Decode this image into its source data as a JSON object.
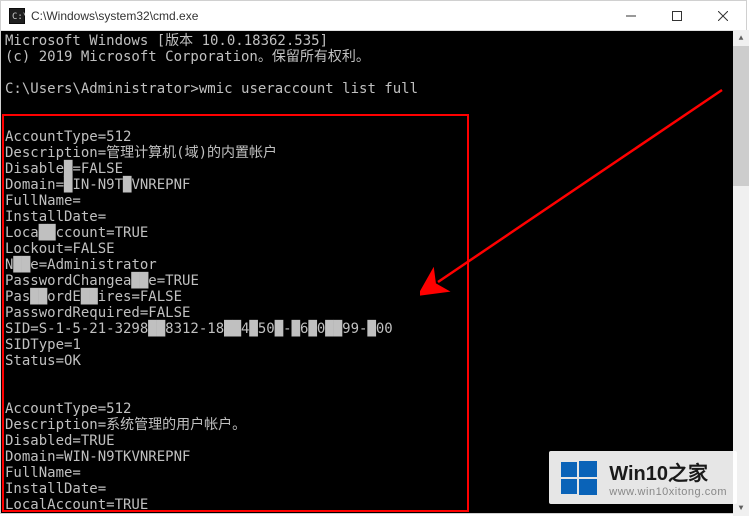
{
  "window": {
    "title": "C:\\Windows\\system32\\cmd.exe"
  },
  "terminal": {
    "banner1": "Microsoft Windows [版本 10.0.18362.535]",
    "banner2": "(c) 2019 Microsoft Corporation。保留所有权利。",
    "prompt": "C:\\Users\\Administrator>",
    "command": "wmic useraccount list full",
    "accounts": [
      {
        "AccountType": "512",
        "Description": "管理计算机(域)的内置帐户",
        "Disabled": "FALSE",
        "Domain": "WIN-N9TKVNREPNF",
        "FullName": "",
        "InstallDate": "",
        "LocalAccount": "TRUE",
        "Lockout": "FALSE",
        "Name": "Administrator",
        "PasswordChangeable": "TRUE",
        "PasswordExpires": "FALSE",
        "PasswordRequired": "FALSE",
        "SID": "S-1-5-21-3298██8312-18██4█50█-█6█0██99-█00",
        "SIDType": "1",
        "Status": "OK"
      },
      {
        "AccountType": "512",
        "Description": "系统管理的用户帐户。",
        "Disabled": "TRUE",
        "Domain": "WIN-N9TKVNREPNF",
        "FullName": "",
        "InstallDate": "",
        "LocalAccount": "TRUE"
      }
    ],
    "masked": {
      "Disabled_label": "Disable█",
      "Domain_value": "█IN-N9T█VNREPNF",
      "LocalAccount_label": "Loca██ccount",
      "Name_label": "N██e",
      "PasswordChangeable_label": "PasswordChangea██e",
      "PasswordExpires_label": "Pas██ordE██ires",
      "SID_value": "S-1-5-21-3298██8312-18██4█50█-█6█0██99-█00"
    }
  },
  "watermark": {
    "title": "Win10之家",
    "url": "www.win10xitong.com"
  },
  "colors": {
    "annotation": "#ff0000",
    "logo": "#0a63b8"
  }
}
